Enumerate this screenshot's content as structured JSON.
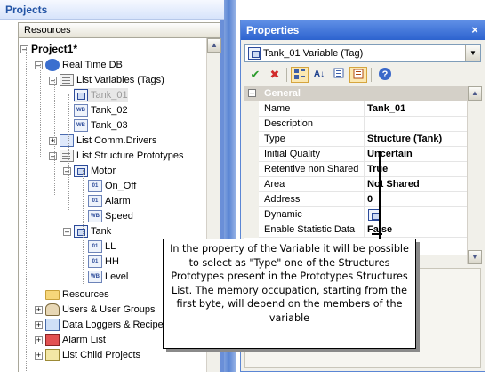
{
  "projects_pane": {
    "title": "Projects",
    "resources_tab": "Resources",
    "tree": [
      {
        "label": "Project1*",
        "icon": "project-icon",
        "bold": true
      },
      {
        "label": "Real Time DB",
        "icon": "database-icon"
      },
      {
        "label": "List Variables (Tags)",
        "icon": "list-icon"
      },
      {
        "label": "Tank_01",
        "icon": "struct-var-icon",
        "selected": true
      },
      {
        "label": "Tank_02",
        "icon": "word-var-icon"
      },
      {
        "label": "Tank_03",
        "icon": "word-var-icon"
      },
      {
        "label": "List Comm.Drivers",
        "icon": "drivers-icon"
      },
      {
        "label": "List Structure Prototypes",
        "icon": "structure-list-icon"
      },
      {
        "label": "Motor",
        "icon": "structure-icon"
      },
      {
        "label": "On_Off",
        "icon": "bit-var-icon"
      },
      {
        "label": "Alarm",
        "icon": "bit-var-icon"
      },
      {
        "label": "Speed",
        "icon": "word-var-icon"
      },
      {
        "label": "Tank",
        "icon": "structure-icon"
      },
      {
        "label": "LL",
        "icon": "bit-var-icon"
      },
      {
        "label": "HH",
        "icon": "bit-var-icon"
      },
      {
        "label": "Level",
        "icon": "word-var-icon"
      },
      {
        "label": "Resources",
        "icon": "folder-icon"
      },
      {
        "label": "Users & User Groups",
        "icon": "users-icon"
      },
      {
        "label": "Data Loggers & Recipe",
        "icon": "data-logger-icon"
      },
      {
        "label": "Alarm List",
        "icon": "alarm-icon"
      },
      {
        "label": "List Child Projects",
        "icon": "child-projects-icon"
      }
    ]
  },
  "properties_pane": {
    "title": "Properties",
    "close_glyph": "×",
    "selected_object": "Tank_01 Variable (Tag)",
    "category": "General",
    "rows": [
      {
        "name": "Name",
        "value": "Tank_01"
      },
      {
        "name": "Description",
        "value": ""
      },
      {
        "name": "Type",
        "value": "Structure (Tank)"
      },
      {
        "name": "Initial Quality",
        "value": "Uncertain"
      },
      {
        "name": "Retentive non Shared",
        "value": "True"
      },
      {
        "name": "Area",
        "value": "Not Shared"
      },
      {
        "name": "Address",
        "value": "0"
      },
      {
        "name": "Dynamic",
        "value": ""
      },
      {
        "name": "Enable Statistic Data",
        "value": "False"
      }
    ],
    "toolbar": {
      "ok_glyph": "✔",
      "cancel_glyph": "✖",
      "sort_glyph": "A↓",
      "help_glyph": "?"
    }
  },
  "callout": {
    "text": "In the property of the Variable it will be possible to select as \"Type\" one of the Structures Prototypes present in the Prototypes Structures List. The memory occupation, starting from the first byte, will depend on the members of the variable"
  }
}
